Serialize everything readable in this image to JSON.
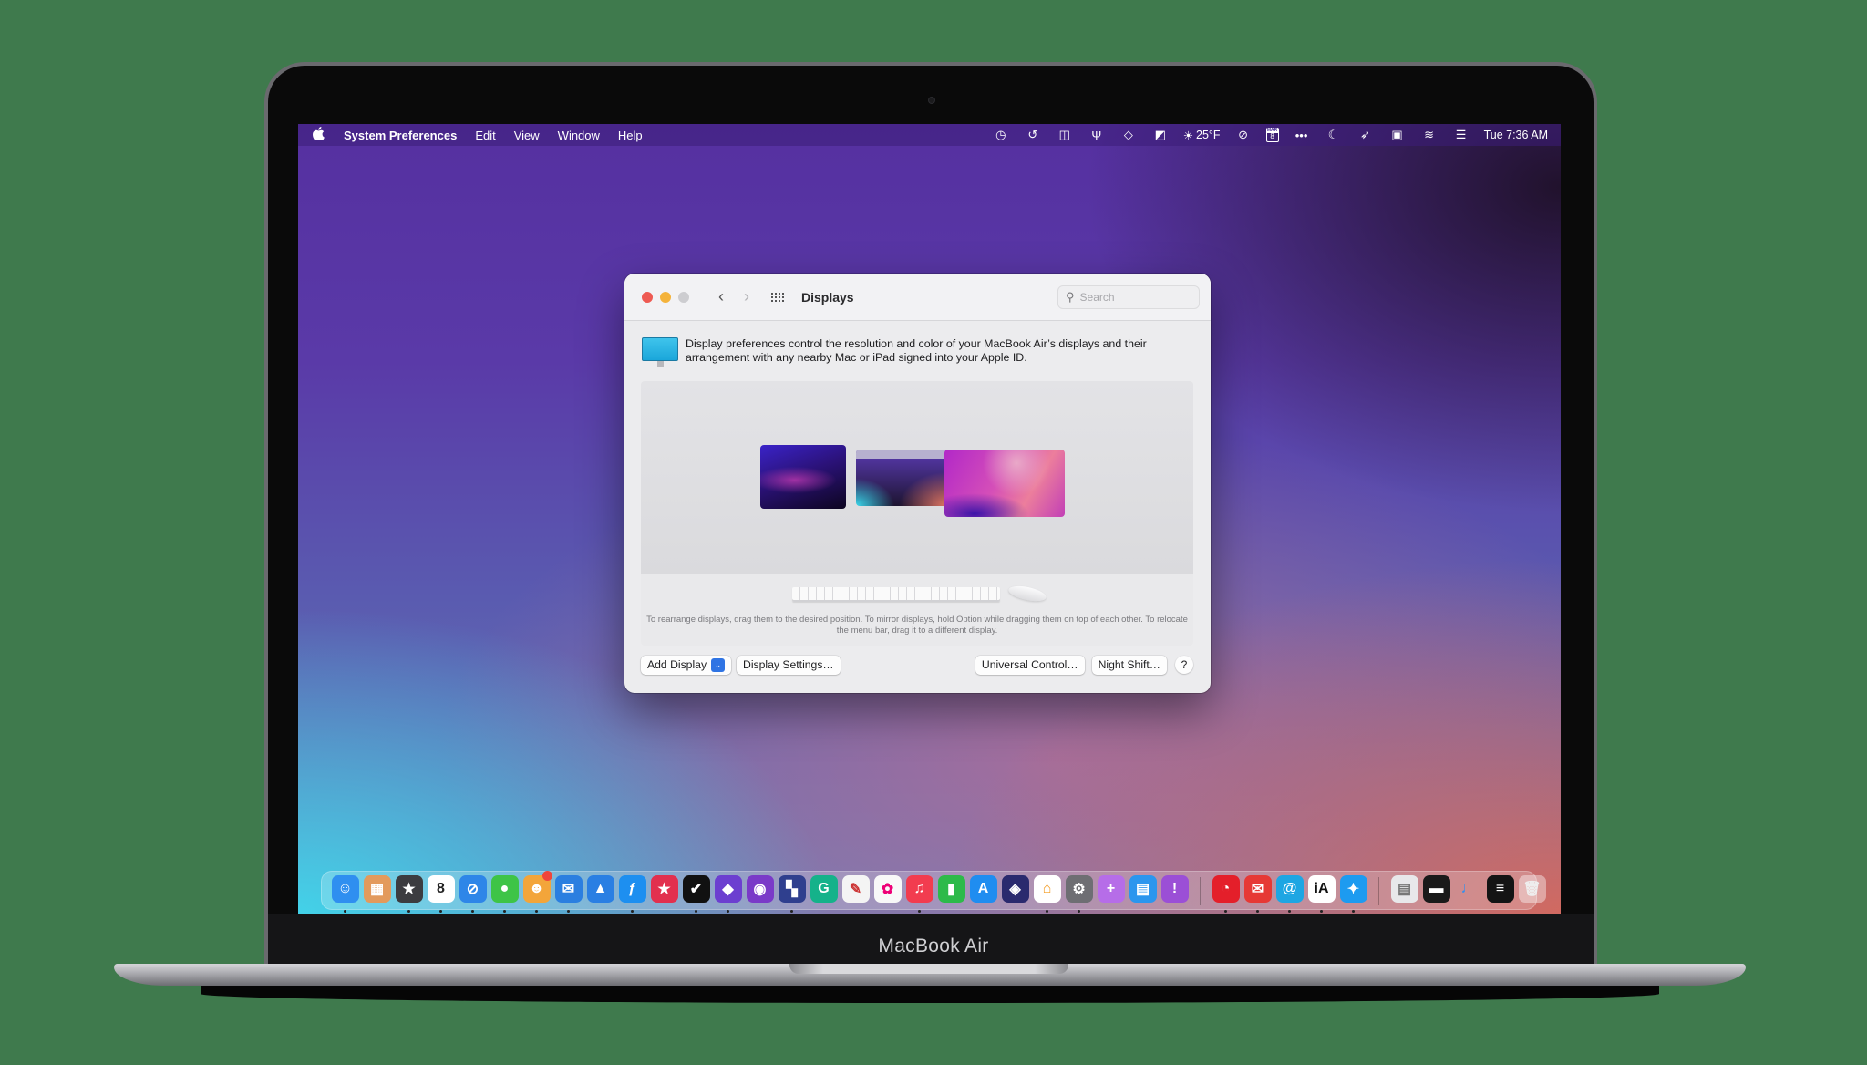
{
  "device": {
    "label": "MacBook Air"
  },
  "menubar": {
    "app_name": "System Preferences",
    "menus": [
      "Edit",
      "View",
      "Window",
      "Help"
    ],
    "status_icons": [
      {
        "name": "time-machine-icon",
        "glyph": "◷"
      },
      {
        "name": "restore-icon",
        "glyph": "↺"
      },
      {
        "name": "split-view-icon",
        "glyph": "◫"
      },
      {
        "name": "usb-icon",
        "glyph": "Ψ"
      },
      {
        "name": "layers-icon",
        "glyph": "◇"
      },
      {
        "name": "screenshot-icon",
        "glyph": "◩"
      }
    ],
    "weather": {
      "glyph": "☀",
      "temp": "25°F"
    },
    "status_icons_2": [
      {
        "name": "check-circle-icon",
        "glyph": "⊘"
      }
    ],
    "calendar": {
      "month": "MAR",
      "day": "8"
    },
    "status_icons_3": [
      {
        "name": "more-icon",
        "glyph": "•••"
      },
      {
        "name": "moon-icon",
        "glyph": "☾"
      },
      {
        "name": "rocket-icon",
        "glyph": "➶"
      },
      {
        "name": "menu-app-icon",
        "glyph": "▣"
      },
      {
        "name": "wifi-icon",
        "glyph": "≋"
      },
      {
        "name": "control-center-icon",
        "glyph": "☰"
      }
    ],
    "clock": "Tue 7:36 AM"
  },
  "window": {
    "title": "Displays",
    "search_placeholder": "Search",
    "description": "Display preferences control the resolution and color of your MacBook Air’s displays and their arrangement with any nearby Mac or iPad signed into your Apple ID.",
    "hint": "To rearrange displays, drag them to the desired position. To mirror displays, hold Option while dragging them on top of each other. To relocate the menu bar, drag it to a different display.",
    "buttons": {
      "add_display": "Add Display",
      "display_settings": "Display Settings…",
      "universal_control": "Universal Control…",
      "night_shift": "Night Shift…",
      "help": "?"
    },
    "displays": [
      "display-1",
      "display-2",
      "display-3"
    ]
  },
  "dock": {
    "apps": [
      {
        "name": "finder",
        "glyph": "☺",
        "bg": "#2f8ff0",
        "running": true
      },
      {
        "name": "package",
        "glyph": "▦",
        "bg": "#e39a5c",
        "running": false
      },
      {
        "name": "reeder",
        "glyph": "★",
        "bg": "#3c3c40",
        "running": true
      },
      {
        "name": "calendar",
        "glyph": "8",
        "bg": "#ffffff",
        "fg": "#222",
        "running": true
      },
      {
        "name": "safari",
        "glyph": "⊘",
        "bg": "#2e86e8",
        "running": true
      },
      {
        "name": "messages",
        "glyph": "●",
        "bg": "#3ec447",
        "running": true
      },
      {
        "name": "discord",
        "glyph": "☻",
        "bg": "#f3a53a",
        "running": true,
        "badge": "·"
      },
      {
        "name": "mail",
        "glyph": "✉",
        "bg": "#2b7fe0",
        "running": true
      },
      {
        "name": "spark",
        "glyph": "▲",
        "bg": "#2a7fe3",
        "running": false
      },
      {
        "name": "feather",
        "glyph": "ƒ",
        "bg": "#1d8ff0",
        "running": true
      },
      {
        "name": "goodlinks",
        "glyph": "★",
        "bg": "#e2304e",
        "running": false
      },
      {
        "name": "things",
        "glyph": "✔",
        "bg": "#111111",
        "running": true
      },
      {
        "name": "obsidian",
        "glyph": "◆",
        "bg": "#6c3fd0",
        "running": true
      },
      {
        "name": "github",
        "glyph": "◉",
        "bg": "#7a3ac8",
        "running": false
      },
      {
        "name": "craft",
        "glyph": "▚",
        "bg": "#2f3f8e",
        "running": true
      },
      {
        "name": "grammarly",
        "glyph": "G",
        "bg": "#15b28a",
        "running": false
      },
      {
        "name": "pixelmator",
        "glyph": "✎",
        "bg": "#f4f4f4",
        "fg": "#c33",
        "running": false
      },
      {
        "name": "photos",
        "glyph": "✿",
        "bg": "#f8f8f8",
        "fg": "#e07",
        "running": false
      },
      {
        "name": "music",
        "glyph": "♫",
        "bg": "#f23c4f",
        "running": true
      },
      {
        "name": "numbers",
        "glyph": "▮",
        "bg": "#2dba4a",
        "running": false
      },
      {
        "name": "app-store",
        "glyph": "A",
        "bg": "#1f8df0",
        "running": false
      },
      {
        "name": "shortcuts",
        "glyph": "◈",
        "bg": "#2a2a6e",
        "running": false
      },
      {
        "name": "home",
        "glyph": "⌂",
        "bg": "#ffffff",
        "fg": "#f39a1d",
        "running": true
      },
      {
        "name": "system-preferences",
        "glyph": "⚙",
        "bg": "#6e6e73",
        "running": true
      },
      {
        "name": "add-app",
        "glyph": "+",
        "bg": "#b66de8",
        "running": false
      },
      {
        "name": "pages",
        "glyph": "▤",
        "bg": "#2b96ee",
        "running": false
      },
      {
        "name": "feedback",
        "glyph": "!",
        "bg": "#9b4fd6",
        "running": false
      }
    ],
    "apps_2": [
      {
        "name": "timing",
        "glyph": "◔",
        "bg": "#e41f2a",
        "running": true
      },
      {
        "name": "cardhop",
        "glyph": "✉",
        "bg": "#e63935",
        "running": true
      },
      {
        "name": "scrobbles",
        "glyph": "@",
        "bg": "#1ea6e3",
        "running": true
      },
      {
        "name": "ia-writer",
        "glyph": "iA",
        "bg": "#ffffff",
        "fg": "#111",
        "running": true
      },
      {
        "name": "twitter",
        "glyph": "✦",
        "bg": "#1d9bf0",
        "running": true
      }
    ],
    "recents": [
      {
        "name": "document-preview",
        "glyph": "▤",
        "bg": "#e8e8ea",
        "fg": "#777"
      },
      {
        "name": "terminal-preview",
        "glyph": "▬",
        "bg": "#1a1a1a"
      },
      {
        "name": "app-preview",
        "glyph": "♩",
        "bg": "rgba(0,0,0,0)",
        "fg": "#2f8ff0"
      },
      {
        "name": "terminal-window",
        "glyph": "≡",
        "bg": "#141414"
      },
      {
        "name": "trash",
        "glyph": "🗑",
        "bg": "rgba(255,255,255,0.4)",
        "fg": "#eee"
      }
    ]
  }
}
